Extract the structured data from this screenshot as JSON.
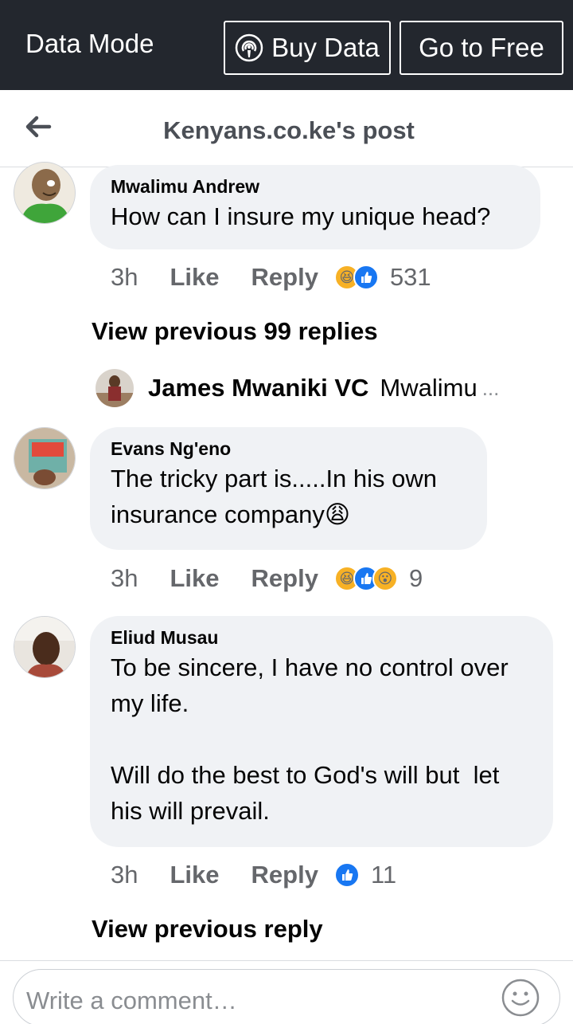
{
  "topbar": {
    "mode_label": "Data Mode",
    "buy_label": "Buy Data",
    "free_label": "Go to Free"
  },
  "header": {
    "title": "Kenyans.co.ke's post"
  },
  "comments": [
    {
      "author": "Mwalimu Andrew",
      "text": "How can I insure my unique head?",
      "time": "3h",
      "like": "Like",
      "reply": "Reply",
      "reactions": [
        "haha",
        "like"
      ],
      "count": "531"
    },
    {
      "author": "Evans Ng'eno",
      "text": "The tricky part is.....In his own insurance company😩",
      "time": "3h",
      "like": "Like",
      "reply": "Reply",
      "reactions": [
        "haha",
        "like",
        "wow"
      ],
      "count": "9"
    },
    {
      "author": "Eliud Musau",
      "text": "To be sincere, I have no control over my life.\n\nWill do the best to God's will but  let his will prevail.",
      "time": "3h",
      "like": "Like",
      "reply": "Reply",
      "reactions": [
        "like"
      ],
      "count": "11"
    }
  ],
  "view_previous_replies": "View previous 99 replies",
  "reply_preview": {
    "author": "James Mwaniki VC",
    "text": "Mwalimu",
    "ellipsis": "..."
  },
  "view_previous_reply": "View previous reply",
  "composer": {
    "placeholder": "Write a comment…"
  },
  "colors": {
    "topbar_bg": "#23272e",
    "bubble_bg": "#f0f2f5",
    "like_blue": "#1877f2",
    "reaction_yellow": "#f7b125",
    "meta_grey": "#65676b"
  }
}
